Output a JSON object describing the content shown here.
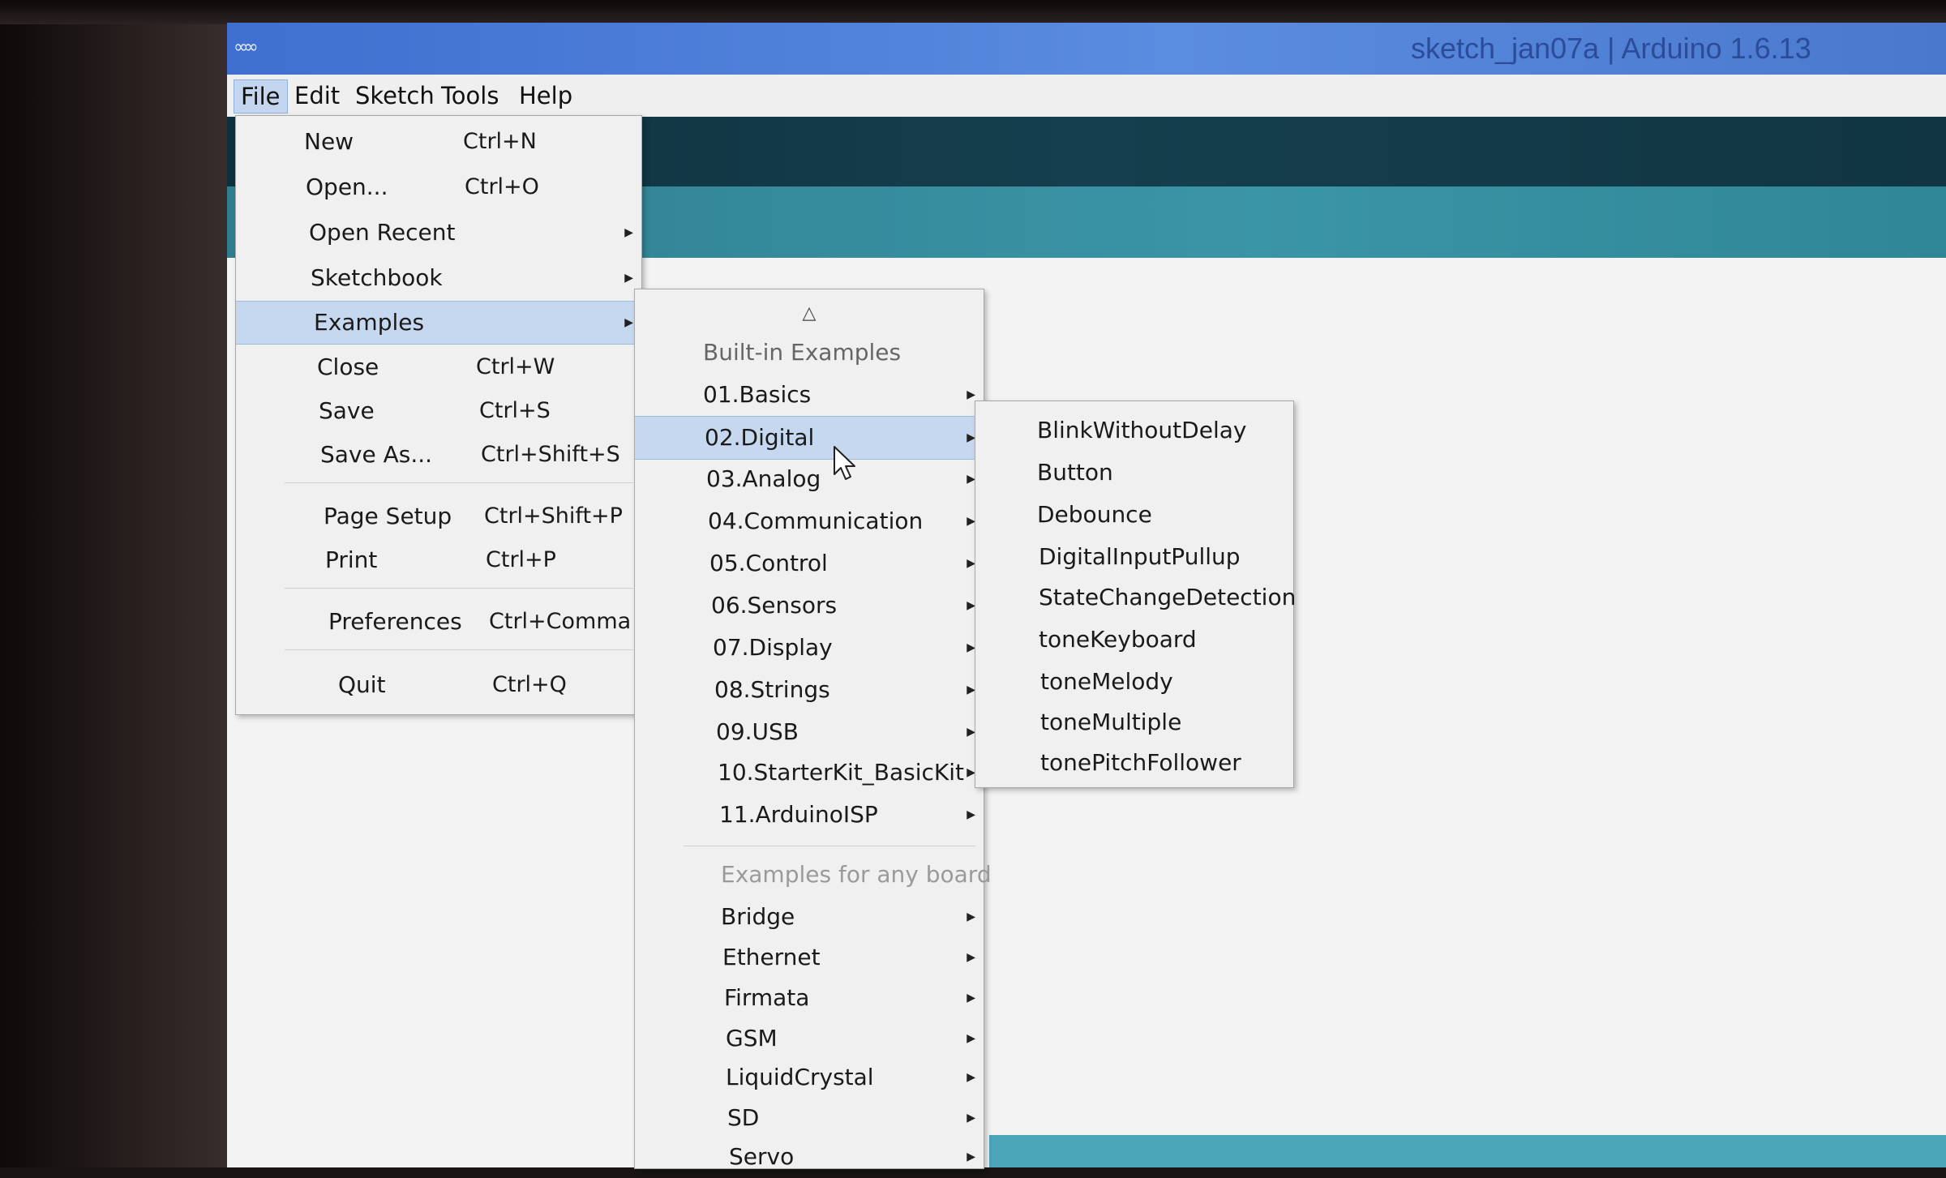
{
  "window": {
    "title": "sketch_jan07a | Arduino 1.6.13"
  },
  "menubar": {
    "items": [
      {
        "label": "File"
      },
      {
        "label": "Edit"
      },
      {
        "label": "Sketch"
      },
      {
        "label": "Tools"
      },
      {
        "label": "Help"
      }
    ],
    "active": "File"
  },
  "file_menu": {
    "items": [
      {
        "label": "New",
        "shortcut": "Ctrl+N"
      },
      {
        "label": "Open...",
        "shortcut": "Ctrl+O"
      },
      {
        "label": "Open Recent",
        "shortcut": ""
      },
      {
        "label": "Sketchbook",
        "shortcut": ""
      },
      {
        "label": "Examples",
        "shortcut": ""
      },
      {
        "label": "Close",
        "shortcut": "Ctrl+W"
      },
      {
        "label": "Save",
        "shortcut": "Ctrl+S"
      },
      {
        "label": "Save As...",
        "shortcut": "Ctrl+Shift+S"
      },
      {
        "label": "Page Setup",
        "shortcut": "Ctrl+Shift+P"
      },
      {
        "label": "Print",
        "shortcut": "Ctrl+P"
      },
      {
        "label": "Preferences",
        "shortcut": "Ctrl+Comma"
      },
      {
        "label": "Quit",
        "shortcut": "Ctrl+Q"
      }
    ],
    "highlighted": "Examples"
  },
  "examples_menu": {
    "scroll_up_glyph": "△",
    "builtin_header": "Built-in Examples",
    "builtin": [
      {
        "label": "01.Basics"
      },
      {
        "label": "02.Digital"
      },
      {
        "label": "03.Analog"
      },
      {
        "label": "04.Communication"
      },
      {
        "label": "05.Control"
      },
      {
        "label": "06.Sensors"
      },
      {
        "label": "07.Display"
      },
      {
        "label": "08.Strings"
      },
      {
        "label": "09.USB"
      },
      {
        "label": "10.StarterKit_BasicKit"
      },
      {
        "label": "11.ArduinoISP"
      }
    ],
    "anyboard_header": "Examples for any board",
    "anyboard": [
      {
        "label": "Bridge"
      },
      {
        "label": "Ethernet"
      },
      {
        "label": "Firmata"
      },
      {
        "label": "GSM"
      },
      {
        "label": "LiquidCrystal"
      },
      {
        "label": "SD"
      },
      {
        "label": "Servo"
      }
    ],
    "highlighted": "02.Digital"
  },
  "digital_menu": {
    "items": [
      {
        "label": "BlinkWithoutDelay"
      },
      {
        "label": "Button"
      },
      {
        "label": "Debounce"
      },
      {
        "label": "DigitalInputPullup"
      },
      {
        "label": "StateChangeDetection"
      },
      {
        "label": "toneKeyboard"
      },
      {
        "label": "toneMelody"
      },
      {
        "label": "toneMultiple"
      },
      {
        "label": "tonePitchFollower"
      }
    ]
  },
  "icons": {
    "app": "arduino-infinity-icon",
    "submenu": "submenu-arrow-icon",
    "cursor": "mouse-pointer-icon"
  },
  "colors": {
    "titlebar": "#4a7ad4",
    "highlight": "#c6d8f0",
    "toolbar": "#153f4e",
    "tabstrip": "#3a95a6"
  }
}
